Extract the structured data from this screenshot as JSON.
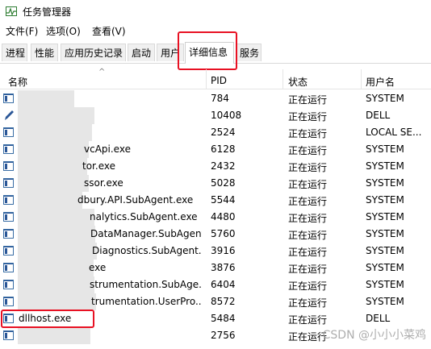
{
  "window": {
    "title": "任务管理器"
  },
  "menu": [
    {
      "label": "文件(F)"
    },
    {
      "label": "选项(O)"
    },
    {
      "label": "查看(V)"
    }
  ],
  "tabs": [
    {
      "label": "进程"
    },
    {
      "label": "性能"
    },
    {
      "label": "应用历史记录"
    },
    {
      "label": "启动"
    },
    {
      "label": "用户"
    },
    {
      "label": "详细信息"
    },
    {
      "label": "服务"
    }
  ],
  "active_tab": "详细信息",
  "columns": [
    {
      "label": "名称"
    },
    {
      "label": "PID"
    },
    {
      "label": "状态"
    },
    {
      "label": "用户名"
    }
  ],
  "rows": [
    {
      "name": "",
      "pid": "784",
      "status": "正在运行",
      "user": "SYSTEM",
      "icon": "process-icon"
    },
    {
      "name": "",
      "pid": "10408",
      "status": "正在运行",
      "user": "DELL",
      "icon": "pen-icon"
    },
    {
      "name": "",
      "pid": "2524",
      "status": "正在运行",
      "user": "LOCAL SE...",
      "icon": "process-icon"
    },
    {
      "name": "vcApi.exe",
      "pid": "6128",
      "status": "正在运行",
      "user": "SYSTEM",
      "icon": "process-icon"
    },
    {
      "name": "tor.exe",
      "pid": "2432",
      "status": "正在运行",
      "user": "SYSTEM",
      "icon": "process-icon"
    },
    {
      "name": "ssor.exe",
      "pid": "5028",
      "status": "正在运行",
      "user": "SYSTEM",
      "icon": "process-icon"
    },
    {
      "name": "dbury.API.SubAgent.exe",
      "pid": "5544",
      "status": "正在运行",
      "user": "SYSTEM",
      "icon": "process-icon"
    },
    {
      "name": "nalytics.SubAgent.exe",
      "pid": "4480",
      "status": "正在运行",
      "user": "SYSTEM",
      "icon": "process-icon"
    },
    {
      "name": "DataManager.SubAgent...",
      "pid": "5760",
      "status": "正在运行",
      "user": "SYSTEM",
      "icon": "process-icon"
    },
    {
      "name": "Diagnostics.SubAgent.exe",
      "pid": "3916",
      "status": "正在运行",
      "user": "SYSTEM",
      "icon": "process-icon"
    },
    {
      "name": "exe",
      "pid": "3876",
      "status": "正在运行",
      "user": "SYSTEM",
      "icon": "process-icon"
    },
    {
      "name": "strumentation.SubAge...",
      "pid": "6404",
      "status": "正在运行",
      "user": "SYSTEM",
      "icon": "process-icon"
    },
    {
      "name": "trumentation.UserPro...",
      "pid": "8572",
      "status": "正在运行",
      "user": "SYSTEM",
      "icon": "process-icon"
    },
    {
      "name": "dllhost.exe",
      "pid": "5484",
      "status": "正在运行",
      "user": "DELL",
      "icon": "process-icon"
    },
    {
      "name": "",
      "pid": "2756",
      "status": "正在运行",
      "user": "",
      "icon": "process-icon"
    }
  ],
  "highlight_color": "#e81123",
  "watermark": "CSDN @小小小菜鸡"
}
